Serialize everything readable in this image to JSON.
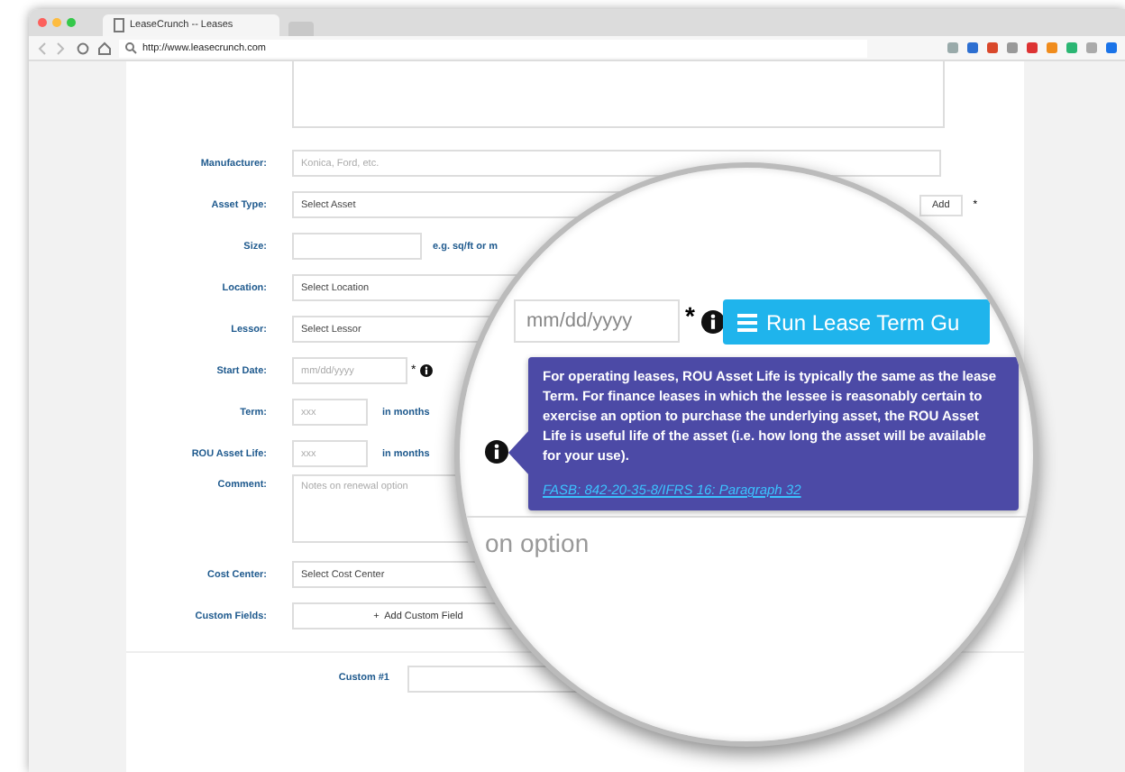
{
  "browser": {
    "tab_title": "LeaseCrunch -- Leases",
    "url": "http://www.leasecrunch.com"
  },
  "form": {
    "rows": [
      {
        "kind": "text",
        "label": "Manufacturer:",
        "placeholder": "Konica, Ford, etc."
      },
      {
        "kind": "select",
        "label": "Asset Type:",
        "value": "Select Asset",
        "button": "Add",
        "mark": "*"
      },
      {
        "kind": "short",
        "label": "Size:",
        "suffix": "e.g. sq/ft or m"
      },
      {
        "kind": "select",
        "label": "Location:",
        "value": "Select Location"
      },
      {
        "kind": "select",
        "label": "Lessor:",
        "value": "Select Lessor"
      },
      {
        "kind": "date",
        "label": "Start Date:",
        "placeholder": "mm/dd/yyyy",
        "mark": "*"
      },
      {
        "kind": "short",
        "label": "Term:",
        "placeholder": "xxx",
        "suffix": "in months"
      },
      {
        "kind": "short",
        "label": "ROU Asset Life:",
        "placeholder": "xxx",
        "suffix": "in months"
      },
      {
        "kind": "textarea",
        "label": "Comment:",
        "placeholder": "Notes on renewal option"
      },
      {
        "kind": "select",
        "label": "Cost Center:",
        "value": "Select Cost Center"
      },
      {
        "kind": "button",
        "label": "Custom Fields:",
        "button": "+  Add Custom Field"
      },
      {
        "kind": "custom",
        "label": "Custom #1"
      }
    ]
  },
  "magnifier": {
    "date_placeholder": "mm/dd/yyyy",
    "mark": "*",
    "button": "Run Lease Term Gu",
    "behind_text": "on option",
    "tooltip": {
      "text": "For operating leases, ROU Asset Life is typically the same as the lease Term.  For finance leases in which the lessee is reasonably certain to exercise an option to purchase the underlying asset, the ROU Asset Life is useful life of the asset (i.e. how long the asset will be available for your use).",
      "link": "FASB: 842-20-35-8/IFRS 16: Paragraph 32"
    }
  }
}
